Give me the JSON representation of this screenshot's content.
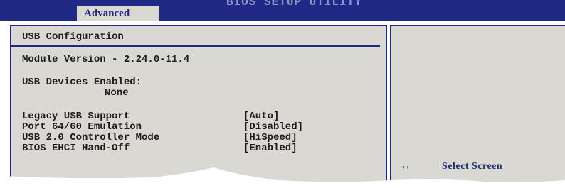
{
  "window": {
    "title": "BIOS SETUP UTILITY",
    "active_tab": "Advanced"
  },
  "panel": {
    "heading": "USB Configuration",
    "module_version": "Module Version - 2.24.0-11.4",
    "devices_label": "USB Devices Enabled:",
    "devices_value": "None",
    "settings": [
      {
        "label": "Legacy USB Support",
        "value": "[Auto]"
      },
      {
        "label": "Port 64/60 Emulation",
        "value": "[Disabled]"
      },
      {
        "label": "USB 2.0 Controller Mode",
        "value": "[HiSpeed]"
      },
      {
        "label": "BIOS EHCI Hand-Off",
        "value": "[Enabled]"
      }
    ]
  },
  "help": {
    "arrows": "↔",
    "select_screen": "Select Screen"
  },
  "colors": {
    "bios_blue": "#1f2a86",
    "panel_gray": "#dad8d2",
    "text": "#1c1c1c"
  }
}
